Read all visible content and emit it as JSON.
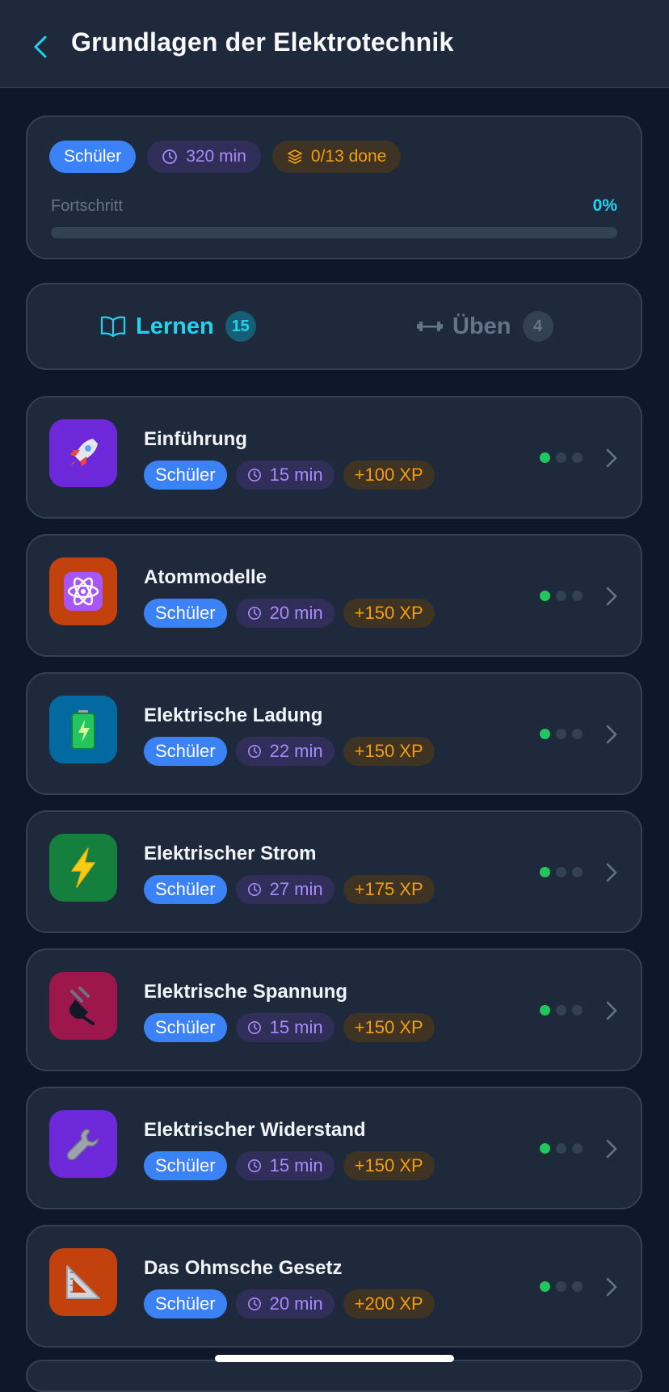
{
  "header": {
    "title": "Grundlagen der Elektrotechnik"
  },
  "course": {
    "level": "Schüler",
    "duration": "320 min",
    "done": "0/13 done",
    "progress_label": "Fortschritt",
    "progress_pct": "0%",
    "progress_value": 0
  },
  "tabs": [
    {
      "label": "Lernen",
      "count": "15",
      "active": true
    },
    {
      "label": "Üben",
      "count": "4",
      "active": false
    }
  ],
  "lessons": [
    {
      "title": "Einführung",
      "level": "Schüler",
      "duration": "15 min",
      "xp": "+100 XP",
      "icon": "rocket-icon",
      "color": "#6d28d9",
      "dots_done": 1
    },
    {
      "title": "Atommodelle",
      "level": "Schüler",
      "duration": "20 min",
      "xp": "+150 XP",
      "icon": "atom-icon",
      "color": "#c2410c",
      "dots_done": 1
    },
    {
      "title": "Elektrische Ladung",
      "level": "Schüler",
      "duration": "22 min",
      "xp": "+150 XP",
      "icon": "battery-icon",
      "color": "#0369a1",
      "dots_done": 1
    },
    {
      "title": "Elektrischer Strom",
      "level": "Schüler",
      "duration": "27 min",
      "xp": "+175 XP",
      "icon": "lightning-icon",
      "color": "#15803d",
      "dots_done": 1
    },
    {
      "title": "Elektrische Spannung",
      "level": "Schüler",
      "duration": "15 min",
      "xp": "+150 XP",
      "icon": "plug-icon",
      "color": "#9d174d",
      "dots_done": 1
    },
    {
      "title": "Elektrischer Widerstand",
      "level": "Schüler",
      "duration": "15 min",
      "xp": "+150 XP",
      "icon": "wrench-icon",
      "color": "#6d28d9",
      "dots_done": 1
    },
    {
      "title": "Das Ohmsche Gesetz",
      "level": "Schüler",
      "duration": "20 min",
      "xp": "+200 XP",
      "icon": "set-square-icon",
      "color": "#c2410c",
      "dots_done": 1
    }
  ],
  "colors": {
    "accent": "#22d3ee",
    "level_chip": "#3b82f6",
    "xp": "#f59e0b",
    "duration": "#a78bfa",
    "done_dot": "#22c55e"
  }
}
